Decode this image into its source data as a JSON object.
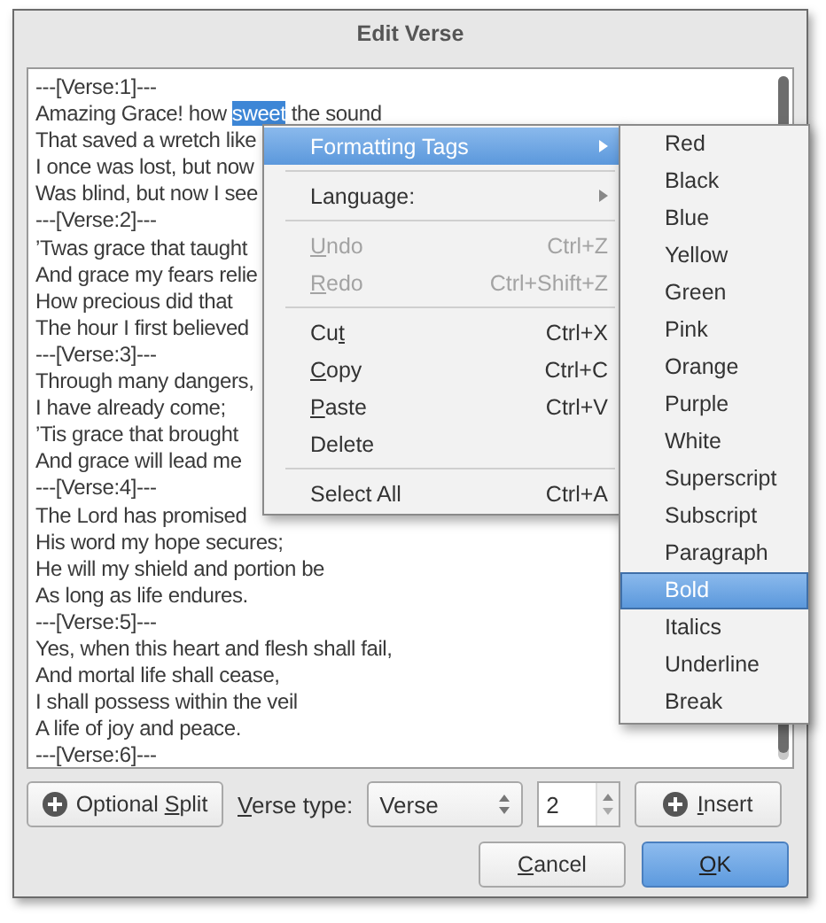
{
  "window": {
    "title": "Edit Verse"
  },
  "editor": {
    "lines": [
      {
        "text": "---[Verse:1]---"
      },
      {
        "text": "Amazing Grace! how ",
        "selected_text": "sweet",
        "after": " the sound"
      },
      {
        "text": "That saved a wretch like"
      },
      {
        "text": "I once was lost, but now"
      },
      {
        "text": "Was blind, but now I see"
      },
      {
        "text": "---[Verse:2]---"
      },
      {
        "text": "’Twas grace that taught"
      },
      {
        "text": "And grace my fears relie"
      },
      {
        "text": "How precious did that"
      },
      {
        "text": "The hour I first believed"
      },
      {
        "text": "---[Verse:3]---"
      },
      {
        "text": "Through many dangers,"
      },
      {
        "text": "I have already come;"
      },
      {
        "text": "’Tis grace that brought"
      },
      {
        "text": "And grace will lead me"
      },
      {
        "text": "---[Verse:4]---"
      },
      {
        "text": "The Lord has promised"
      },
      {
        "text": "His word my hope secures;"
      },
      {
        "text": "He will my shield and portion be"
      },
      {
        "text": "As long as life endures."
      },
      {
        "text": "---[Verse:5]---"
      },
      {
        "text": "Yes, when this heart and flesh shall fail,"
      },
      {
        "text": "And mortal life shall cease,"
      },
      {
        "text": "I shall possess within the veil"
      },
      {
        "text": "A life of joy and peace."
      },
      {
        "text": "---[Verse:6]---"
      }
    ]
  },
  "context_menu": {
    "items": [
      {
        "kind": "item",
        "label": [
          {
            "text": "Formatting Tags"
          }
        ],
        "selected": true,
        "disabled": false,
        "submenu": true
      },
      {
        "kind": "separator"
      },
      {
        "kind": "item",
        "label": [
          {
            "text": "Language:"
          }
        ],
        "selected": false,
        "disabled": false,
        "submenu": true
      },
      {
        "kind": "separator"
      },
      {
        "kind": "item",
        "label": [
          {
            "text": "U",
            "underlined": true
          },
          {
            "text": "ndo"
          }
        ],
        "shortcut": "Ctrl+Z",
        "selected": false,
        "disabled": true,
        "submenu": false
      },
      {
        "kind": "item",
        "label": [
          {
            "text": "R",
            "underlined": true
          },
          {
            "text": "edo"
          }
        ],
        "shortcut": "Ctrl+Shift+Z",
        "selected": false,
        "disabled": true,
        "submenu": false
      },
      {
        "kind": "separator"
      },
      {
        "kind": "item",
        "label": [
          {
            "text": "Cu"
          },
          {
            "text": "t",
            "underlined": true
          }
        ],
        "shortcut": "Ctrl+X",
        "selected": false,
        "disabled": false,
        "submenu": false
      },
      {
        "kind": "item",
        "label": [
          {
            "text": "C",
            "underlined": true
          },
          {
            "text": "opy"
          }
        ],
        "shortcut": "Ctrl+C",
        "selected": false,
        "disabled": false,
        "submenu": false
      },
      {
        "kind": "item",
        "label": [
          {
            "text": "P",
            "underlined": true
          },
          {
            "text": "aste"
          }
        ],
        "shortcut": "Ctrl+V",
        "selected": false,
        "disabled": false,
        "submenu": false
      },
      {
        "kind": "item",
        "label": [
          {
            "text": "Delete"
          }
        ],
        "selected": false,
        "disabled": false,
        "submenu": false
      },
      {
        "kind": "separator"
      },
      {
        "kind": "item",
        "label": [
          {
            "text": "Select All"
          }
        ],
        "shortcut": "Ctrl+A",
        "selected": false,
        "disabled": false,
        "submenu": false
      }
    ]
  },
  "submenu": {
    "items": [
      {
        "label": "Red",
        "selected": false
      },
      {
        "label": "Black",
        "selected": false
      },
      {
        "label": "Blue",
        "selected": false
      },
      {
        "label": "Yellow",
        "selected": false
      },
      {
        "label": "Green",
        "selected": false
      },
      {
        "label": "Pink",
        "selected": false
      },
      {
        "label": "Orange",
        "selected": false
      },
      {
        "label": "Purple",
        "selected": false
      },
      {
        "label": "White",
        "selected": false
      },
      {
        "label": "Superscript",
        "selected": false
      },
      {
        "label": "Subscript",
        "selected": false
      },
      {
        "label": "Paragraph",
        "selected": false
      },
      {
        "label": "Bold",
        "selected": true
      },
      {
        "label": "Italics",
        "selected": false
      },
      {
        "label": "Underline",
        "selected": false
      },
      {
        "label": "Break",
        "selected": false
      }
    ]
  },
  "controls": {
    "split_button": {
      "label": [
        {
          "text": "Optional "
        },
        {
          "text": "S",
          "underlined": true
        },
        {
          "text": "plit"
        }
      ]
    },
    "verse_type_label": [
      {
        "text": "V",
        "underlined": true
      },
      {
        "text": "erse type:"
      }
    ],
    "verse_type": {
      "value": "Verse"
    },
    "verse_number": {
      "value": "2"
    },
    "insert_button": {
      "label": [
        {
          "text": "I",
          "underlined": true
        },
        {
          "text": "nsert"
        }
      ]
    }
  },
  "buttons": [
    {
      "kind": "normal",
      "label": [
        {
          "text": "C",
          "underlined": true
        },
        {
          "text": "ancel"
        }
      ]
    },
    {
      "kind": "default",
      "label": [
        {
          "text": "O",
          "underlined": true
        },
        {
          "text": "K"
        }
      ]
    }
  ]
}
